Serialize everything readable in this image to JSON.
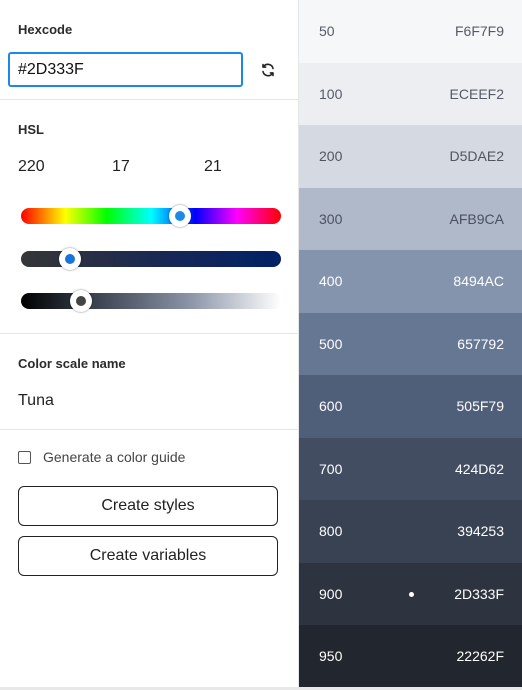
{
  "hexcode": {
    "label": "Hexcode",
    "value": "#2D333F"
  },
  "hsl": {
    "label": "HSL",
    "h": "220",
    "s": "17",
    "l": "21",
    "hue_fraction": 0.61,
    "saturation_fraction": 0.19,
    "lightness_fraction": 0.23
  },
  "scale_name": {
    "label": "Color scale name",
    "value": "Tuna"
  },
  "guide": {
    "label": "Generate a color guide",
    "checked": false
  },
  "buttons": {
    "create_styles": "Create styles",
    "create_variables": "Create variables"
  },
  "icons": {
    "refresh": "refresh-icon",
    "marker": "selected-dot-icon"
  },
  "swatches": [
    {
      "step": "50",
      "hex": "F6F7F9",
      "bg": "#F6F7F9",
      "fg": "#555b66"
    },
    {
      "step": "100",
      "hex": "ECEEF2",
      "bg": "#ECEEF2",
      "fg": "#555b66"
    },
    {
      "step": "200",
      "hex": "D5DAE2",
      "bg": "#D5DAE2",
      "fg": "#505660"
    },
    {
      "step": "300",
      "hex": "AFB9CA",
      "bg": "#AFB9CA",
      "fg": "#4a5060"
    },
    {
      "step": "400",
      "hex": "8494AC",
      "bg": "#8494AC",
      "fg": "#ffffff"
    },
    {
      "step": "500",
      "hex": "657792",
      "bg": "#657792",
      "fg": "#ffffff"
    },
    {
      "step": "600",
      "hex": "505F79",
      "bg": "#505F79",
      "fg": "#ffffff"
    },
    {
      "step": "700",
      "hex": "424D62",
      "bg": "#424D62",
      "fg": "#ffffff"
    },
    {
      "step": "800",
      "hex": "394253",
      "bg": "#394253",
      "fg": "#ffffff"
    },
    {
      "step": "900",
      "hex": "2D333F",
      "bg": "#2D333F",
      "fg": "#ffffff",
      "selected": true
    },
    {
      "step": "950",
      "hex": "22262F",
      "bg": "#22262F",
      "fg": "#ffffff"
    }
  ],
  "colors": {
    "accent": "#1e88e5",
    "input_border": "#1e88e5"
  }
}
